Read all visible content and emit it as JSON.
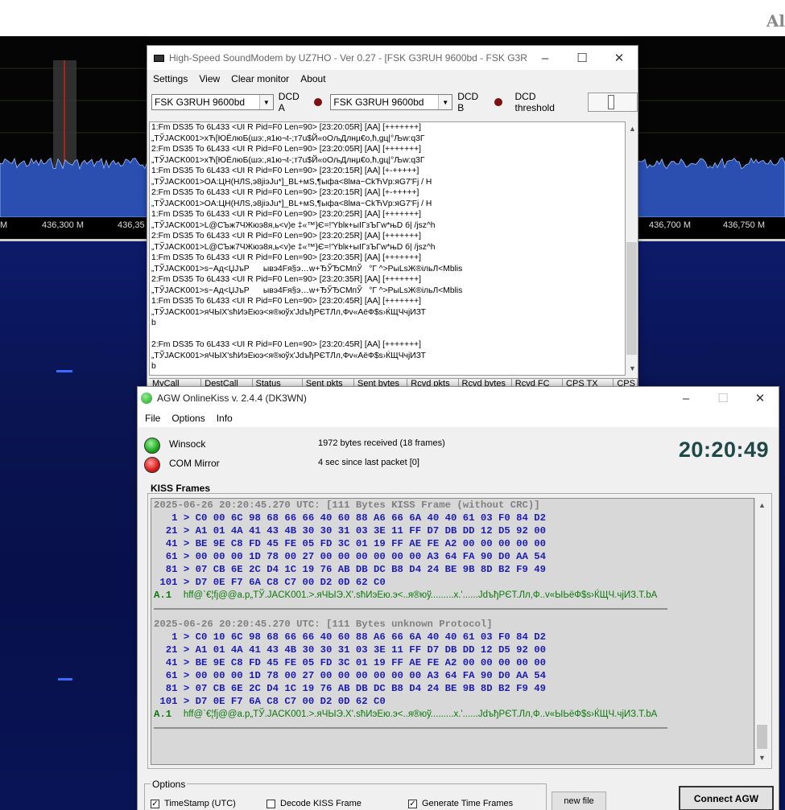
{
  "background_app": {
    "logo": "Al",
    "freq_labels": [
      "M",
      "436,300 M",
      "436,35",
      "436,700 M",
      "436,750 M"
    ]
  },
  "soundmodem": {
    "title": "High-Speed SoundModem by UZ7HO - Ver 0.27 - [FSK G3RUH 9600bd - FSK G3RU...",
    "menu": [
      "Settings",
      "View",
      "Clear monitor",
      "About"
    ],
    "modem_a": "FSK G3RUH 9600bd",
    "dcd_a": "DCD A",
    "modem_b": "FSK G3RUH 9600bd",
    "dcd_b": "DCD B",
    "dcd_threshold": "DCD threshold",
    "monitor_text": "1:Fm DS35 To 6L433 <UI R Pid=F0 Len=90> [23:20:05R] [AA] [+++++++]\n„ТЎJACK001>хЋ[ЮЁлюБ(шэ:,я1ю¬t-;т7u$Й«оОљДлнµ€о,ћ,gц|°Љw:q3Г\n2:Fm DS35 To 6L433 <UI R Pid=F0 Len=90> [23:20:05R] [AA] [+++++++]\n„ТЎJACK001>хЋ[ЮЁлюБ(шэ:,я1ю¬t-;т7u$Й«оОљДлнµ€о,ћ,gц|°Љw:q3Г\n1:Fm DS35 To 6L433 <UI R Pid=F0 Len=90> [23:20:15R] [AA] [+-+++++]\n„ТЎJACK001>OA:ЦН(НЛS,э8jiэJu*]_BL+мS,¶ыфа<8lма~СkЋVp:яG7'Fj / H\n2:Fm DS35 To 6L433 <UI R Pid=F0 Len=90> [23:20:15R] [AA] [+-+++++]\n„ТЎJACK001>OA:ЦН(НЛS,э8jiэJu*]_BL+мS,¶ыфа<8lма~СkЋVp:яG7'Fj / H\n1:Fm DS35 To 6L433 <UI R Pid=F0 Len=90> [23:20:25R] [AA] [+++++++]\n„ТЎJACK001>L@СЪж7ЧЖюэ8я,ь<v)e ‡«™}Є=!'Yblк+ыIГзЪГw*њD б| /jsz^h\n2:Fm DS35 To 6L433 <UI R Pid=F0 Len=90> [23:20:25R] [AA] [+++++++]\n„ТЎJACK001>L@СЪж7ЧЖюэ8я,ь<v)e ‡«™}Є=!'Yblк+ыIГзЪГw*њD б| /jsz^h\n1:Fm DS35 To 6L433 <UI R Pid=F0 Len=90> [23:20:35R] [AA] [+++++++]\n„ТЎJACK001>s~Ад<ЏЈъР      ывэ4Fя§э…w+ЂЎЂСМпЎ   °Г ^>РыLsЖ®ільЛ<Мblis\n2:Fm DS35 To 6L433 <UI R Pid=F0 Len=90> [23:20:35R] [AA] [+++++++]\n„ТЎJACK001>s~Ад<ЏЈъР      ывэ4Fя§э…w+ЂЎЂСМпЎ   °Г ^>РыLsЖ®ільЛ<Мblis\n1:Fm DS35 To 6L433 <UI R Pid=F0 Len=90> [23:20:45R] [AA] [+++++++]\n„ТЎJACK001>яЧЫХ'sћИэЕюэ<я®юўх'JdъђРЄТЛл,Фv«АёФ$s›ЌЩЧчjИЗТ\nb\n\n2:Fm DS35 To 6L433 <UI R Pid=F0 Len=90> [23:20:45R] [AA] [+++++++]\n„ТЎJACK001>яЧЫХ'sћИэЕюэ<я®юўх'JdъђРЄТЛл,Фv«АёФ$s›ЌЩЧчjИЗТ\nb",
    "columns": [
      "MyCall",
      "DestCall",
      "Status",
      "Sent pkts",
      "Sent bytes",
      "Rcvd pkts",
      "Rcvd bytes",
      "Rcvd FC",
      "CPS TX",
      "CPS"
    ]
  },
  "agw": {
    "title": "AGW OnlineKiss v. 2.4.4  (DK3WN)",
    "menu": [
      "File",
      "Options",
      "Info"
    ],
    "winsock_label": "Winsock",
    "com_label": "COM Mirror",
    "bytes_status": "1972 bytes received (18 frames)",
    "packet_status": "4 sec since last packet [0]",
    "clock": "20:20:49",
    "kiss_frames_label": "KISS Frames",
    "frames": [
      {
        "header": "2025-06-26 20:20:45.270 UTC: [111 Bytes KISS Frame (without CRC)]",
        "hex": [
          "   1 > C0 00 6C 98 68 66 66 40 60 88 A6 66 6A 40 40 61 03 F0 84 D2",
          "  21 > A1 01 4A 41 43 4B 30 30 31 03 3E 11 FF D7 DB DD 12 D5 92 00",
          "  41 > BE 9E C8 FD 45 FE 05 FD 3C 01 19 FF AE FE A2 00 00 00 00 00",
          "  61 > 00 00 00 1D 78 00 27 00 00 00 00 00 00 A3 64 FA 90 D0 AA 54",
          "  81 > 07 CB 6E 2C D4 1C 19 76 AB DB DC B8 D4 24 BE 9B 8D B2 F9 49",
          " 101 > D7 0E F7 6A C8 C7 00 D2 0D 62 C0"
        ],
        "ascii_prefix": "A.1",
        "ascii": "hff@`€¦fj@@a.p„ТЎ.JACK001.>.яЧЫЭ.Х'.sћИэЕю.э<..я®юў.........х.'......JdъђРЄТ.Лл,Ф..v«ЫЬёФ$s›ЌЩЧ.чјИЗ.Т.bA"
      },
      {
        "header": "2025-06-26 20:20:45.270 UTC: [111 Bytes unknown Protocol]",
        "hex": [
          "   1 > C0 10 6C 98 68 66 66 40 60 88 A6 66 6A 40 40 61 03 F0 84 D2",
          "  21 > A1 01 4A 41 43 4B 30 30 31 03 3E 11 FF D7 DB DD 12 D5 92 00",
          "  41 > BE 9E C8 FD 45 FE 05 FD 3C 01 19 FF AE FE A2 00 00 00 00 00",
          "  61 > 00 00 00 1D 78 00 27 00 00 00 00 00 00 A3 64 FA 90 D0 AA 54",
          "  81 > 07 CB 6E 2C D4 1C 19 76 AB DB DC B8 D4 24 BE 9B 8D B2 F9 49",
          " 101 > D7 0E F7 6A C8 C7 00 D2 0D 62 C0"
        ],
        "ascii_prefix": "A.1",
        "ascii": "hff@`€¦fj@@a.p„ТЎ.JACK001.>.яЧЫЭ.Х'.sћИэЕю.э<..я®юў.........х.'......JdъђРЄТ.Лл,Ф..v«ЫЬёФ$s›ЌЩЧ.чјИЗ.Т.bA"
      }
    ],
    "options_label": "Options",
    "opt_timestamp": "TimeStamp (UTC)",
    "opt_decode": "Decode KISS Frame",
    "opt_generate": "Generate Time Frames",
    "new_file": "new file",
    "connect": "Connect AGW"
  }
}
